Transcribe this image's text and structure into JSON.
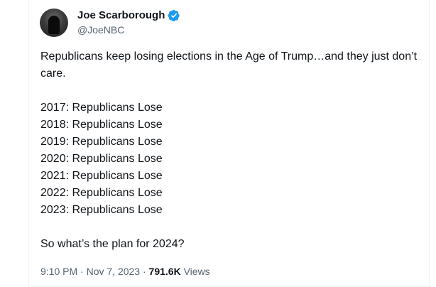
{
  "author": {
    "display_name": "Joe Scarborough",
    "handle": "@JoeNBC",
    "verified_badge_color": "#1d9bf0"
  },
  "tweet": {
    "intro": "Republicans keep losing elections in the Age of Trump…and they just don’t care.",
    "list": [
      "2017: Republicans Lose",
      "2018: Republicans Lose",
      "2019: Republicans Lose",
      "2020: Republicans Lose",
      "2021: Republicans Lose",
      "2022: Republicans Lose",
      "2023: Republicans Lose"
    ],
    "closing": "So what’s the plan for 2024?"
  },
  "meta": {
    "time": "9:10 PM",
    "separator": "·",
    "date": "Nov 7, 2023",
    "views_count": "791.6K",
    "views_label": "Views"
  },
  "colors": {
    "text": "#0f1419",
    "secondary": "#536471",
    "border": "#eff3f4"
  }
}
